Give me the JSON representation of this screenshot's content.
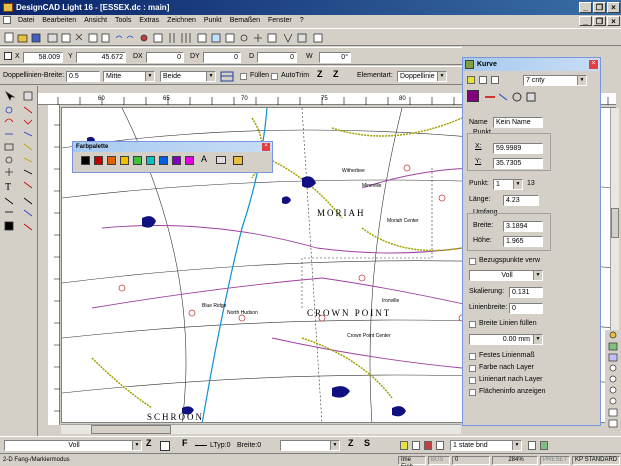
{
  "window": {
    "title": "DesignCAD Light 16 - [ESSEX.dc : main]",
    "minimize": "_",
    "restore": "❐",
    "close": "×"
  },
  "menu": [
    "Datei",
    "Bearbeiten",
    "Ansicht",
    "Tools",
    "Extras",
    "Zeichnen",
    "Punkt",
    "Bemaßen",
    "Fenster",
    "?"
  ],
  "coords": {
    "x_label": "X",
    "x_value": "58.009",
    "y_label": "Y",
    "y_value": "45.672",
    "dx_label": "DX",
    "dx_value": "0",
    "dy_label": "DY",
    "dy_value": "0",
    "d_label": "D",
    "d_value": "0",
    "w_label": "W",
    "w_value": "0°"
  },
  "lineopts": {
    "width_label": "Doppellinien-Breite:",
    "width_value": "0.5",
    "unit_value": "Mitte",
    "side_value": "Beide",
    "fill_label": "Füllen",
    "autotrim_label": "AutoTrim",
    "element_label": "Elementart:",
    "element_value": "Doppellinie"
  },
  "palette": {
    "title": "Farbpalette",
    "colors": [
      "#000000",
      "#c00000",
      "#e06000",
      "#f0c000",
      "#40c040",
      "#00c0c0",
      "#0060e0",
      "#8000c0",
      "#e000e0"
    ]
  },
  "map_labels": {
    "moriah": "MORIAH",
    "crownpoint": "CROWN POINT",
    "schroon": "SCHROON",
    "bluerridge": "Blue Ridge",
    "northhudson": "North Hudson",
    "witherbee": "Witherbee",
    "mineville": "Mineville",
    "moriahcenter": "Moriah Center",
    "crownpointcenter": "Crown Point Center",
    "ironville": "Ironville"
  },
  "kurve": {
    "title": "Kurve",
    "layer_value": "7  cnty",
    "name_label": "Name",
    "name_value": "Kein Name",
    "punkt_group": "Punkt",
    "x_label": "X:",
    "x_value": "59.9989",
    "y_label": "Y:",
    "y_value": "35.7305",
    "punkt_label": "Punkt:",
    "punkt_value": "1",
    "punkt_total": "13",
    "laenge_label": "Länge:",
    "laenge_value": "4.23",
    "umfang_group": "Umfang",
    "breite_label": "Breite:",
    "breite_value": "3.1894",
    "hoehe_label": "Höhe:",
    "hoehe_value": "1.965",
    "bezug_label": "Bezugspunkte verw",
    "linetype_value": "Voll",
    "skalierung_label": "Skalierung:",
    "skalierung_value": "0.131",
    "linienbreite_label": "Linienbreite:",
    "linienbreite_value": "0",
    "breite_linien_label": "Breite Linien füllen",
    "mm_value": "0.00 mm",
    "festes_label": "Festes Linienmaß",
    "farbe_label": "Farbe nach Layer",
    "linienart_label": "Linienart nach Layer",
    "flaechen_label": "Flächeninfo anzeigen"
  },
  "bottombar": {
    "linetype": "Voll",
    "ltyp": "LTyp:0",
    "breite": "Breite:0",
    "layer": "1  state bnd"
  },
  "status": {
    "left": "2-D Fang-/Markiermodus",
    "unit": "Ime Einh.",
    "bus": "BUS",
    "zero": "0",
    "zoom": "284%",
    "preset": "PRESET",
    "kp": "KP STANDARD"
  }
}
